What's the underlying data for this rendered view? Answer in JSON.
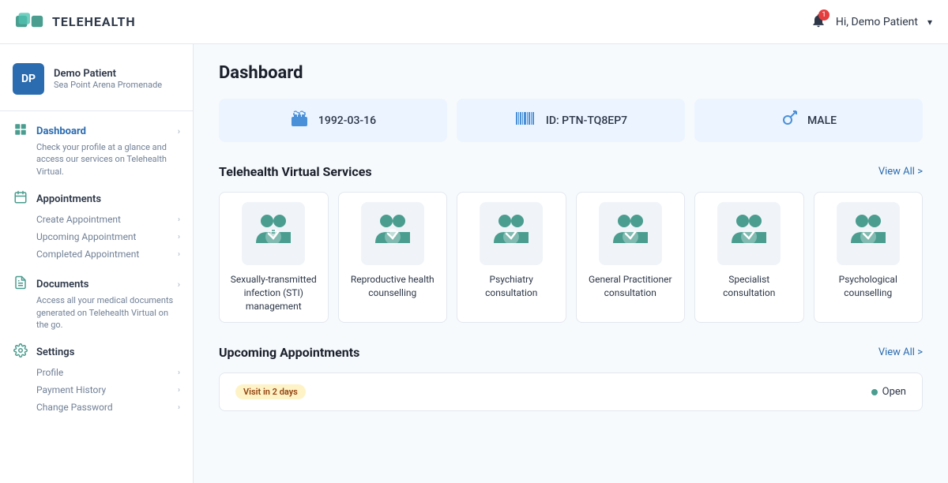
{
  "app": {
    "name": "TELEHEALTH"
  },
  "topnav": {
    "notification_count": "1",
    "user_greeting": "Hi, Demo Patient"
  },
  "sidebar": {
    "user": {
      "initials": "DP",
      "name": "Demo Patient",
      "location": "Sea Point Arena Promenade"
    },
    "nav": [
      {
        "id": "dashboard",
        "label": "Dashboard",
        "active": true,
        "icon": "⊞",
        "description": "Check your profile at a glance and access our services on Telehealth Virtual.",
        "subitems": []
      },
      {
        "id": "appointments",
        "label": "Appointments",
        "active": false,
        "icon": "📅",
        "description": "",
        "subitems": [
          "Create Appointment",
          "Upcoming Appointment",
          "Completed Appointment"
        ]
      },
      {
        "id": "documents",
        "label": "Documents",
        "active": false,
        "icon": "📄",
        "description": "Access all your medical documents generated on Telehealth Virtual on the go.",
        "subitems": []
      },
      {
        "id": "settings",
        "label": "Settings",
        "active": false,
        "icon": "⚙",
        "description": "",
        "subitems": [
          "Profile",
          "Payment History",
          "Change Password"
        ]
      }
    ]
  },
  "dashboard": {
    "title": "Dashboard",
    "info_cards": [
      {
        "icon": "🎂",
        "value": "1992-03-16"
      },
      {
        "icon": "|||",
        "value": "ID: PTN-TQ8EP7"
      },
      {
        "icon": "♂",
        "value": "MALE"
      }
    ],
    "services_section": {
      "title": "Telehealth Virtual Services",
      "view_all": "View All >",
      "services": [
        {
          "label": "Sexually-transmitted infection (STI) management"
        },
        {
          "label": "Reproductive health counselling"
        },
        {
          "label": "Psychiatry consultation"
        },
        {
          "label": "General Practitioner consultation"
        },
        {
          "label": "Specialist consultation"
        },
        {
          "label": "Psychological counselling"
        }
      ]
    },
    "appointments_section": {
      "title": "Upcoming Appointments",
      "view_all": "View All >",
      "appointment": {
        "badge": "Visit in 2 days",
        "status": "Open"
      }
    }
  }
}
